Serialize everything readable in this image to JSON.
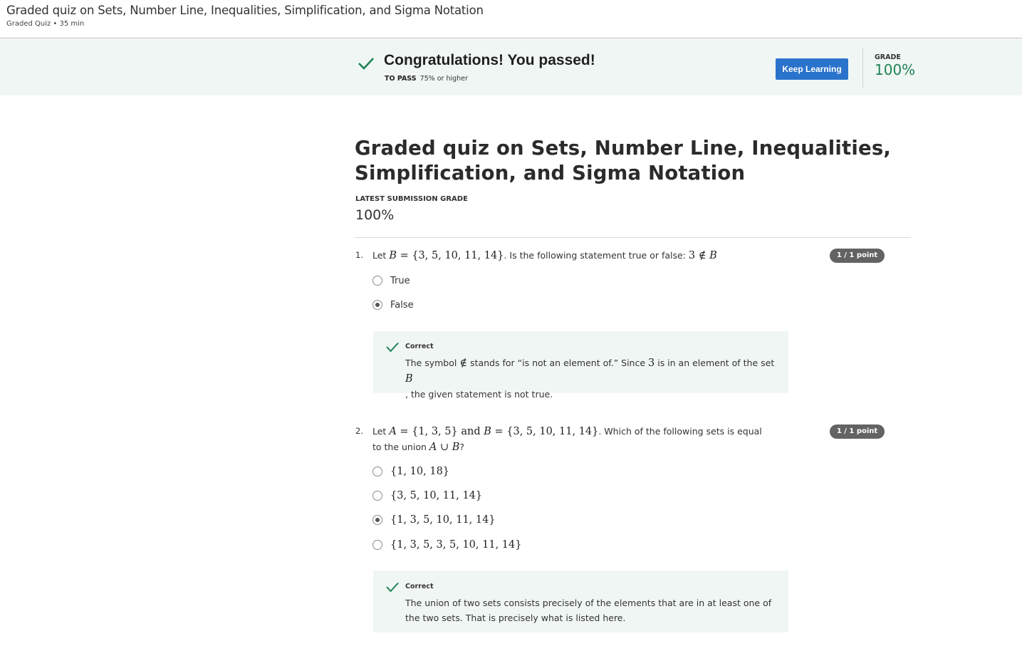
{
  "header": {
    "title": "Graded quiz on Sets, Number Line, Inequalities, Simplification, and Sigma Notation",
    "subtitle": "Graded Quiz • 35 min"
  },
  "banner": {
    "message": "Congratulations! You passed!",
    "to_pass_label": "TO PASS",
    "to_pass_value": "75% or higher",
    "keep_learning": "Keep Learning",
    "grade_label": "GRADE",
    "grade_value": "100%",
    "accent_color": "#1f8354",
    "button_color": "#2a73cc"
  },
  "main": {
    "title": "Graded quiz on Sets, Number Line, Inequalities, Simplification, and Sigma Notation",
    "latest_label": "LATEST SUBMISSION GRADE",
    "latest_value": "100%"
  },
  "questions": [
    {
      "number": "1.",
      "points": "1 / 1 point",
      "text": {
        "p1": "Let ",
        "m1": "B",
        "m2": " = {3, 5, 10, 11, 14}",
        "p2": ". Is the following statement true or false: ",
        "m3": "3 ∉ ",
        "m4": "B"
      },
      "options": [
        {
          "label": "True",
          "selected": false
        },
        {
          "label": "False",
          "selected": true
        }
      ],
      "feedback": {
        "label": "Correct",
        "t1": "The symbol ",
        "m1": "∉",
        "t2": " stands for “is not an element of.” Since ",
        "m2": "3",
        "t3": " is in an element of the set ",
        "m3": "B",
        "t4": ", the given statement is not true."
      }
    },
    {
      "number": "2.",
      "points": "1 / 1 point",
      "text": {
        "p1": "Let ",
        "m1": "A",
        "m2": " = {1, 3, 5}",
        "m3": " and ",
        "m4": "B",
        "m5": " = {3, 5, 10, 11, 14}",
        "p2": ". Which of the following sets is equal to the union ",
        "m6": "A",
        "m7": " ∪ ",
        "m8": "B",
        "p3": "?"
      },
      "options": [
        {
          "label": "{1, 10, 18}",
          "selected": false
        },
        {
          "label": "{3, 5, 10, 11, 14}",
          "selected": false
        },
        {
          "label": "{1, 3, 5, 10, 11, 14}",
          "selected": true
        },
        {
          "label": "{1, 3, 5, 3, 5, 10, 11, 14}",
          "selected": false
        }
      ],
      "feedback": {
        "label": "Correct",
        "text": "The union of two sets consists precisely of the elements that are in at least one of the two sets. That is precisely what is listed here."
      }
    }
  ],
  "icons": [
    "check-icon",
    "radio-icon"
  ]
}
